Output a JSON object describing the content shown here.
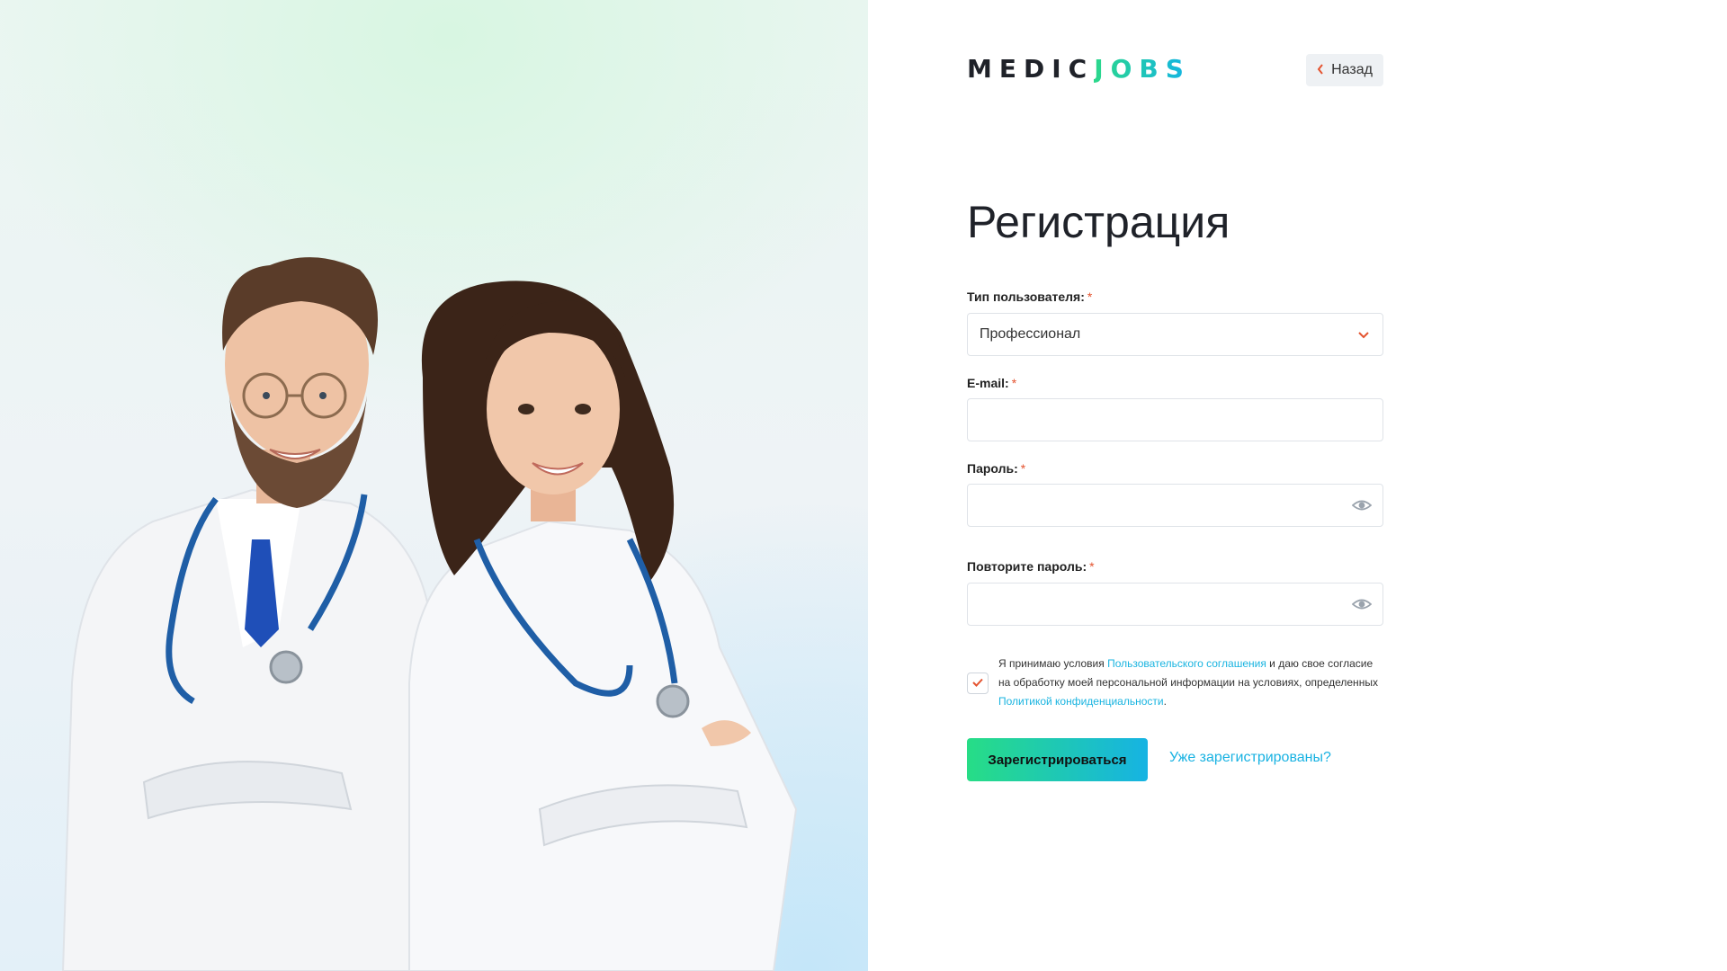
{
  "logo": {
    "part1": "MEDIC",
    "part2": "JOBS"
  },
  "header": {
    "back_label": "Назад"
  },
  "page": {
    "title": "Регистрация"
  },
  "form": {
    "user_type": {
      "label": "Тип пользователя:",
      "required_mark": "*",
      "value": "Профессионал"
    },
    "email": {
      "label": "E-mail:",
      "required_mark": "*",
      "value": ""
    },
    "password": {
      "label": "Пароль:",
      "required_mark": "*",
      "value": ""
    },
    "password_repeat": {
      "label": "Повторите пароль:",
      "required_mark": "*",
      "value": ""
    },
    "consent": {
      "checked": true,
      "text_1": "Я принимаю условия ",
      "link_1": "Пользовательского соглашения",
      "text_2": " и даю свое согласие на обработку моей персональной информации на условиях, определенных ",
      "link_2": "Политикой конфиденциальности",
      "text_3": "."
    },
    "submit_label": "Зарегистрироваться",
    "login_link": "Уже зарегистрированы?"
  },
  "colors": {
    "accent_green": "#27dd86",
    "accent_blue": "#16b3e3",
    "required": "#e4532f",
    "link": "#19b4e0"
  },
  "icons": {
    "back": "chevron-left-icon",
    "select": "chevron-down-icon",
    "password_toggle": "eye-icon",
    "checkbox": "checkmark-icon"
  }
}
